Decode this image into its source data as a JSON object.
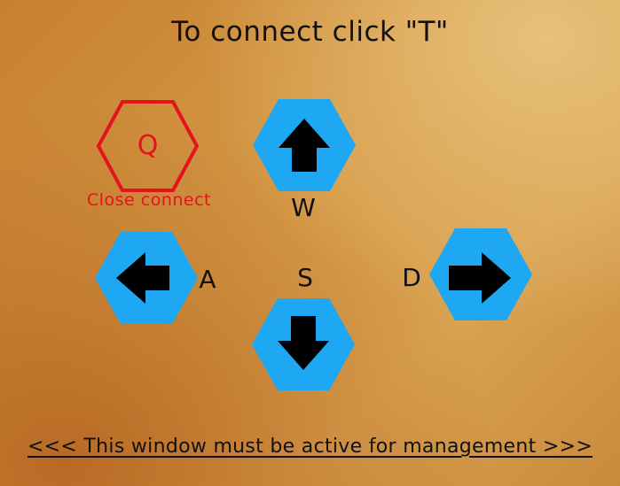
{
  "header": {
    "title": "To connect click \"T\""
  },
  "close_key": {
    "letter": "Q",
    "caption": "Close connect",
    "color": "#e3141d"
  },
  "controls": {
    "accent_color": "#1ea7f2",
    "up": {
      "key": "W",
      "icon": "arrow-up-icon"
    },
    "left": {
      "key": "A",
      "icon": "arrow-left-icon"
    },
    "down": {
      "key": "S",
      "icon": "arrow-down-icon"
    },
    "right": {
      "key": "D",
      "icon": "arrow-right-icon"
    }
  },
  "footer": {
    "notice": "<<< This window must be active for management >>>"
  }
}
